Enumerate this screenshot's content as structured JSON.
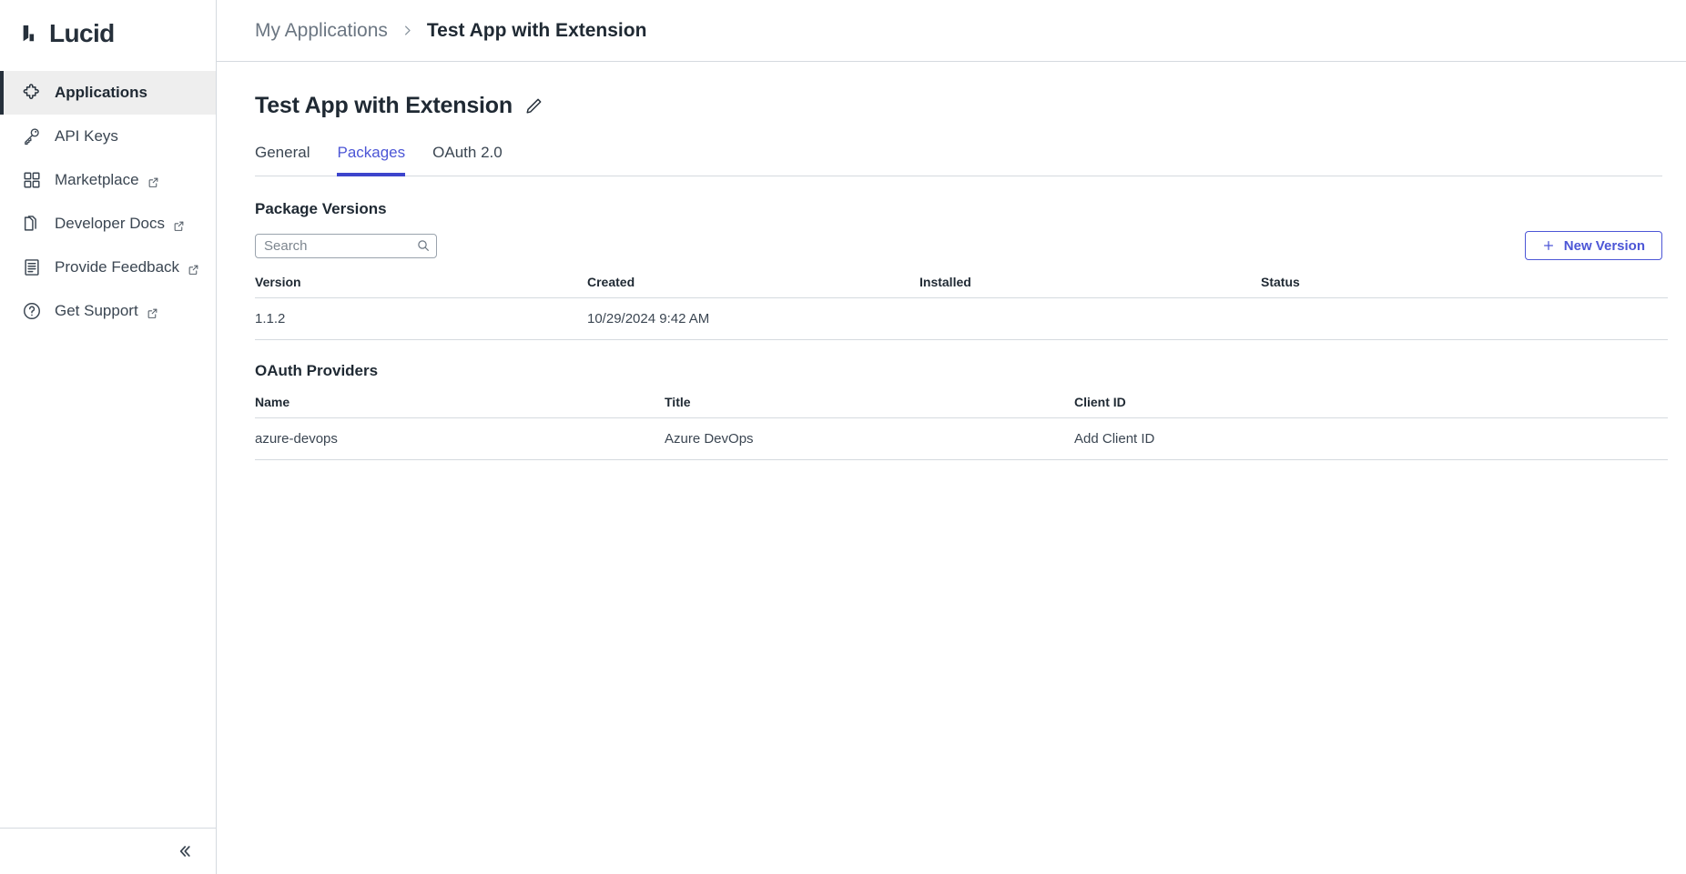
{
  "brand": {
    "name": "Lucid",
    "accent": "#4c56d6",
    "logo_icon": "lucid-logo-mark"
  },
  "sidebar": {
    "items": [
      {
        "label": "Applications",
        "icon": "puzzle-piece-icon",
        "active": true,
        "external": false
      },
      {
        "label": "API Keys",
        "icon": "key-icon",
        "active": false,
        "external": false
      },
      {
        "label": "Marketplace",
        "icon": "grid-squares-icon",
        "active": false,
        "external": true
      },
      {
        "label": "Developer Docs",
        "icon": "stacked-pages-icon",
        "active": false,
        "external": true
      },
      {
        "label": "Provide Feedback",
        "icon": "document-lines-icon",
        "active": false,
        "external": true
      },
      {
        "label": "Get Support",
        "icon": "question-circle-icon",
        "active": false,
        "external": true
      }
    ],
    "collapse_icon": "double-chevron-left-icon"
  },
  "breadcrumb": {
    "parent": "My Applications",
    "separator": "›",
    "current": "Test App with Extension"
  },
  "page": {
    "title": "Test App with Extension",
    "edit_icon": "pencil-icon"
  },
  "tabs": [
    {
      "label": "General",
      "active": false
    },
    {
      "label": "Packages",
      "active": true
    },
    {
      "label": "OAuth 2.0",
      "active": false
    }
  ],
  "packages": {
    "section_title": "Package Versions",
    "search": {
      "value": "",
      "placeholder": "Search",
      "icon": "search-icon"
    },
    "new_version_button": {
      "label": "New Version",
      "icon": "plus-icon"
    },
    "columns": [
      "Version",
      "Created",
      "Installed",
      "Status"
    ],
    "rows": [
      {
        "version": "1.1.2",
        "created": "10/29/2024 9:42 AM",
        "installed": "",
        "status": ""
      }
    ]
  },
  "oauth_providers": {
    "section_title": "OAuth Providers",
    "columns": [
      "Name",
      "Title",
      "Client ID"
    ],
    "rows": [
      {
        "name": "azure-devops",
        "title": "Azure DevOps",
        "client_id": "Add Client ID",
        "client_id_is_link": true
      }
    ]
  }
}
